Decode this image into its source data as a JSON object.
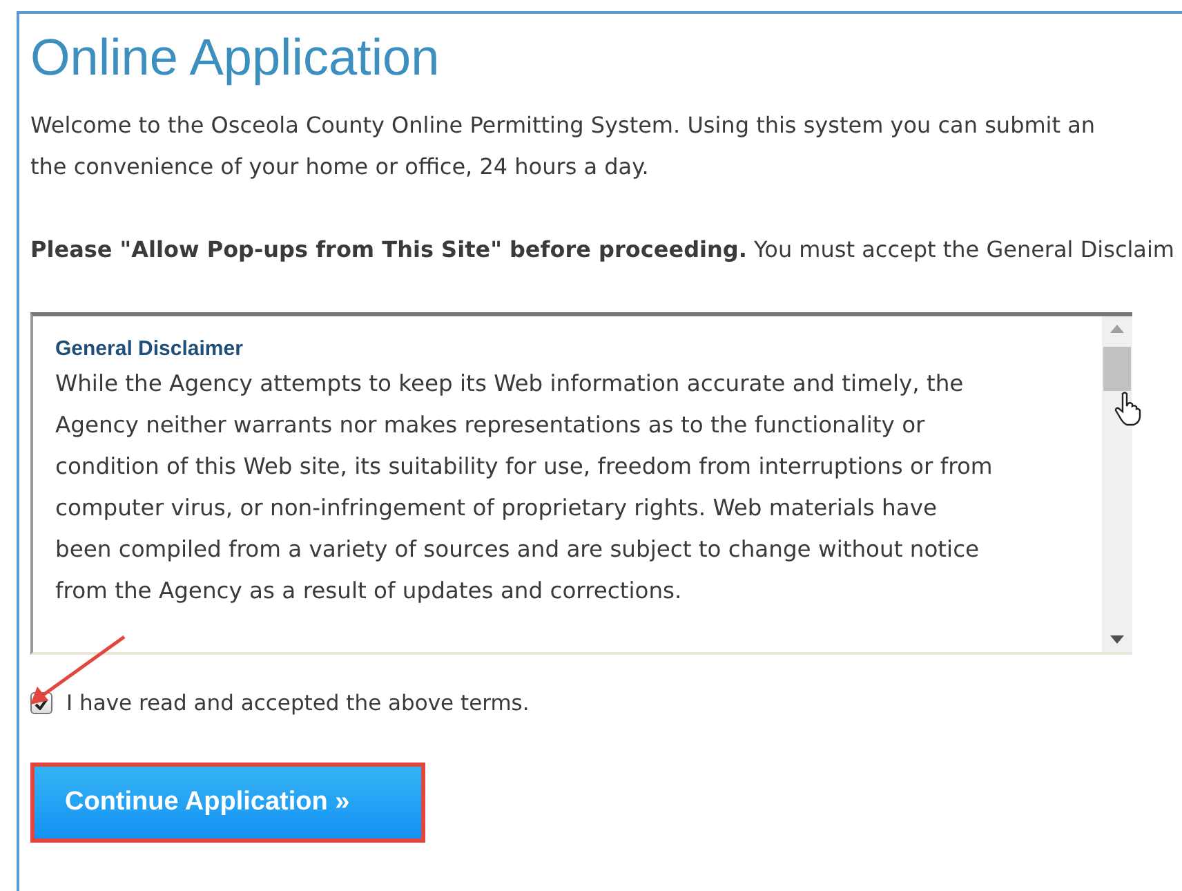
{
  "title": "Online Application",
  "intro_lines": [
    "Welcome to the Osceola County Online Permitting System. Using this system you can submit an",
    "the convenience of your home or office, 24 hours a day."
  ],
  "notice": "**Please \"Allow Pop-ups from This Site\" before proceeding.** You must accept the General Disclaim",
  "disclaimer": {
    "heading": "General Disclaimer",
    "lines": [
      "While the Agency attempts to keep its Web information accurate and timely, the",
      "Agency neither warrants nor makes representations as to the functionality or",
      "condition of this Web site, its suitability for use, freedom from interruptions or from",
      "computer virus, or non-infringement of proprietary rights. Web materials have",
      "been compiled from a variety of sources and are subject to change without notice",
      "from the Agency as a result of updates and corrections."
    ]
  },
  "accept": {
    "label": "I have read and accepted the above terms.",
    "checked": true
  },
  "continue_button": {
    "label": "Continue Application »"
  }
}
